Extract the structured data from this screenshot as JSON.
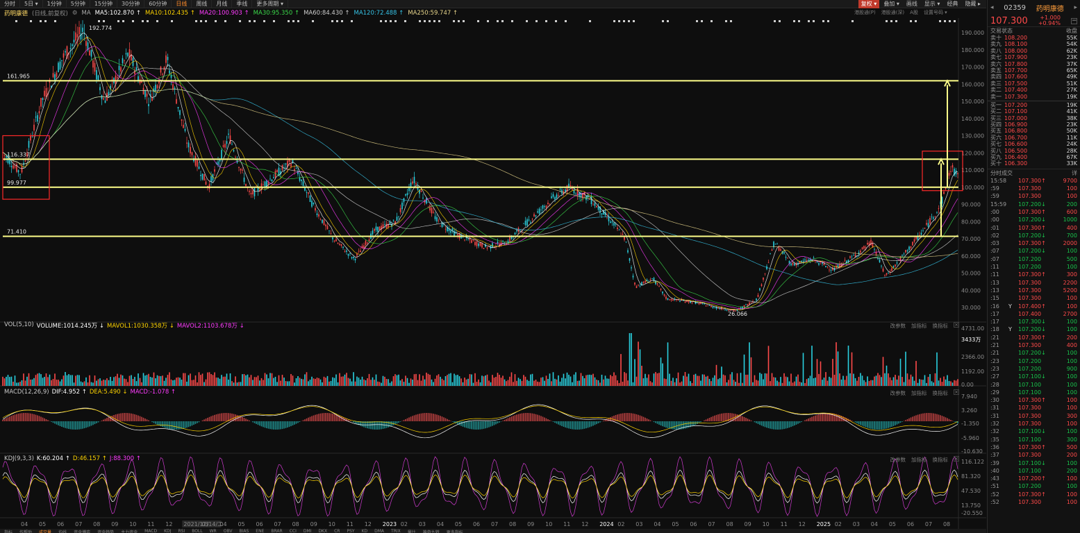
{
  "toolbar": {
    "periods": [
      "分时",
      "5日 ▾",
      "1分钟",
      "5分钟",
      "15分钟",
      "30分钟",
      "60分钟",
      "日线",
      "周线",
      "月线",
      "季线",
      "更多周期 ▾"
    ],
    "active_period": "日线",
    "right": [
      "复权 ▾",
      "叠加 ▾",
      "画线",
      "显示 ▾",
      "经典",
      "隐藏 ▸"
    ]
  },
  "subbar": [
    "港股通(P)",
    "港股通(深)",
    "A股",
    "设置号码 ▾"
  ],
  "ma_legend": {
    "name": "药明康德",
    "sub": "(日线,前复权)",
    "items": [
      {
        "text": "MA5:102.870 ↑",
        "color": "#ffffff"
      },
      {
        "text": "MA10:102.435 ↑",
        "color": "#ffd400"
      },
      {
        "text": "MA20:100.903 ↑",
        "color": "#ff3bff"
      },
      {
        "text": "MA30:95.350 ↑",
        "color": "#3bd94a"
      },
      {
        "text": "MA60:84.430 ↑",
        "color": "#d0d0d0"
      },
      {
        "text": "MA120:72.488 ↑",
        "color": "#36c3e6"
      },
      {
        "text": "MA250:59.747 ↑",
        "color": "#e6d48a"
      }
    ]
  },
  "price_pane": {
    "y_ticks": [
      "190.000",
      "180.000",
      "170.000",
      "160.000",
      "150.000",
      "140.000",
      "130.000",
      "120.000",
      "110.000",
      "100.000",
      "90.000",
      "80.000",
      "70.000",
      "60.000",
      "50.000",
      "40.000",
      "30.000"
    ],
    "levels": [
      {
        "label": "161.965",
        "value": 161.965
      },
      {
        "label": "116.337",
        "value": 116.337
      },
      {
        "label": "99.977",
        "value": 99.977
      },
      {
        "label": "71.410",
        "value": 71.41
      }
    ],
    "high_label": "192.774",
    "low_label": "26.066"
  },
  "vol_pane": {
    "legend": [
      {
        "text": "VOL(5,10)",
        "color": "#c8c8c8"
      },
      {
        "text": "VOLUME:1014.245万 ↓",
        "color": "#ffffff"
      },
      {
        "text": "MAVOL1:1030.358万 ↓",
        "color": "#ffd400"
      },
      {
        "text": "MAVOL2:1103.678万 ↓",
        "color": "#ff3bff"
      }
    ],
    "y_ticks": [
      "4731.00",
      "3433万",
      "2366.00",
      "1192.00",
      "0.00"
    ]
  },
  "macd_pane": {
    "legend": [
      {
        "text": "MACD(12,26,9)",
        "color": "#c8c8c8"
      },
      {
        "text": "DIF:4.952 ↑",
        "color": "#ffffff"
      },
      {
        "text": "DEA:5.490 ↓",
        "color": "#ffd400"
      },
      {
        "text": "MACD:-1.078 ↑",
        "color": "#ff3bff"
      }
    ],
    "y_ticks": [
      "7.940",
      "3.260",
      "-1.350",
      "-5.960",
      "-10.630"
    ]
  },
  "kdj_pane": {
    "legend": [
      {
        "text": "KDJ(9,3,3)",
        "color": "#c8c8c8"
      },
      {
        "text": "K:60.204 ↑",
        "color": "#ffffff"
      },
      {
        "text": "D:46.157 ↑",
        "color": "#ffd400"
      },
      {
        "text": "J:88.300 ↑",
        "color": "#ff3bff"
      }
    ],
    "y_ticks": [
      "116.122",
      "81.320",
      "47.530",
      "13.750",
      "-20.550"
    ]
  },
  "pane_ops": [
    "改参数",
    "加指标",
    "换指标",
    "×"
  ],
  "x_axis": [
    "04",
    "05",
    "06",
    "07",
    "08",
    "09",
    "10",
    "11",
    "12",
    "2021/12/14/二",
    "03",
    "04",
    "05",
    "06",
    "07",
    "08",
    "09",
    "10",
    "11",
    "12",
    "2023",
    "02",
    "03",
    "04",
    "05",
    "06",
    "07",
    "08",
    "09",
    "10",
    "11",
    "12",
    "2024",
    "02",
    "03",
    "04",
    "05",
    "06",
    "07",
    "08",
    "09",
    "10",
    "11",
    "12",
    "2025",
    "02",
    "03",
    "04",
    "05",
    "06",
    "07",
    "08"
  ],
  "bottom_tabs": [
    "指标",
    "作帮助",
    "成交量",
    "均线",
    "资金博弈",
    "资金趋势",
    "主力资金",
    "MACD",
    "KDJ",
    "RSI",
    "BOLL",
    "WR",
    "OBV",
    "BIAS",
    "ENE",
    "BRAR",
    "CCI",
    "DMI",
    "DKX",
    "CR",
    "PSY",
    "KD",
    "DMA",
    "TRIX",
    "量比",
    "神奇九转",
    "更多指标"
  ],
  "panel": {
    "code": "02359",
    "name": "药明康德",
    "price": "107.300",
    "change": "+1.000",
    "change_pct": "+0.94%",
    "orderbook_title": "交易状态",
    "orderbook_right": "收盘",
    "asks": [
      {
        "label": "卖十",
        "price": "108.200",
        "vol": "55K"
      },
      {
        "label": "卖九",
        "price": "108.100",
        "vol": "54K"
      },
      {
        "label": "卖八",
        "price": "108.000",
        "vol": "62K"
      },
      {
        "label": "卖七",
        "price": "107.900",
        "vol": "23K"
      },
      {
        "label": "卖六",
        "price": "107.800",
        "vol": "37K"
      },
      {
        "label": "卖五",
        "price": "107.700",
        "vol": "65K"
      },
      {
        "label": "卖四",
        "price": "107.600",
        "vol": "49K"
      },
      {
        "label": "卖三",
        "price": "107.500",
        "vol": "51K"
      },
      {
        "label": "卖二",
        "price": "107.400",
        "vol": "27K"
      },
      {
        "label": "卖一",
        "price": "107.300",
        "vol": "19K"
      }
    ],
    "bids": [
      {
        "label": "买一",
        "price": "107.200",
        "vol": "19K"
      },
      {
        "label": "买二",
        "price": "107.100",
        "vol": "41K"
      },
      {
        "label": "买三",
        "price": "107.000",
        "vol": "38K"
      },
      {
        "label": "买四",
        "price": "106.900",
        "vol": "23K"
      },
      {
        "label": "买五",
        "price": "106.800",
        "vol": "50K"
      },
      {
        "label": "买六",
        "price": "106.700",
        "vol": "11K"
      },
      {
        "label": "买七",
        "price": "106.600",
        "vol": "24K"
      },
      {
        "label": "买八",
        "price": "106.500",
        "vol": "28K"
      },
      {
        "label": "买九",
        "price": "106.400",
        "vol": "67K"
      },
      {
        "label": "买十",
        "price": "106.300",
        "vol": "33K"
      }
    ],
    "ticks_title": "分时成交",
    "ticks_right": "详",
    "ticks": [
      {
        "t": "15:58",
        "f": "",
        "p": "107.300↑",
        "v": "9700",
        "d": "up"
      },
      {
        "t": ":59",
        "f": "",
        "p": "107.300",
        "v": "100",
        "d": "up"
      },
      {
        "t": ":59",
        "f": "",
        "p": "107.300",
        "v": "100",
        "d": "up"
      },
      {
        "t": "15:59",
        "f": "",
        "p": "107.200↓",
        "v": "200",
        "d": "dn"
      },
      {
        "t": ":00",
        "f": "",
        "p": "107.300↑",
        "v": "600",
        "d": "up"
      },
      {
        "t": ":00",
        "f": "",
        "p": "107.200↓",
        "v": "1000",
        "d": "dn"
      },
      {
        "t": ":01",
        "f": "",
        "p": "107.300↑",
        "v": "400",
        "d": "up"
      },
      {
        "t": ":02",
        "f": "",
        "p": "107.200↓",
        "v": "700",
        "d": "dn"
      },
      {
        "t": ":03",
        "f": "",
        "p": "107.300↑",
        "v": "2000",
        "d": "up"
      },
      {
        "t": ":07",
        "f": "",
        "p": "107.200↓",
        "v": "100",
        "d": "dn"
      },
      {
        "t": ":07",
        "f": "",
        "p": "107.200",
        "v": "500",
        "d": "dn"
      },
      {
        "t": ":11",
        "f": "",
        "p": "107.200",
        "v": "100",
        "d": "dn"
      },
      {
        "t": ":11",
        "f": "",
        "p": "107.300↑",
        "v": "300",
        "d": "up"
      },
      {
        "t": ":13",
        "f": "",
        "p": "107.300",
        "v": "2200",
        "d": "up"
      },
      {
        "t": ":13",
        "f": "",
        "p": "107.300",
        "v": "5200",
        "d": "up"
      },
      {
        "t": ":15",
        "f": "",
        "p": "107.300",
        "v": "100",
        "d": "up"
      },
      {
        "t": ":16",
        "f": "Y",
        "p": "107.400↑",
        "v": "100",
        "d": "up"
      },
      {
        "t": ":17",
        "f": "",
        "p": "107.400",
        "v": "2700",
        "d": "up"
      },
      {
        "t": ":17",
        "f": "",
        "p": "107.300↓",
        "v": "100",
        "d": "dn"
      },
      {
        "t": ":18",
        "f": "Y",
        "p": "107.200↓",
        "v": "100",
        "d": "dn"
      },
      {
        "t": ":21",
        "f": "",
        "p": "107.300↑",
        "v": "200",
        "d": "up"
      },
      {
        "t": ":21",
        "f": "",
        "p": "107.300",
        "v": "400",
        "d": "up"
      },
      {
        "t": ":21",
        "f": "",
        "p": "107.200↓",
        "v": "100",
        "d": "dn"
      },
      {
        "t": ":23",
        "f": "",
        "p": "107.200",
        "v": "100",
        "d": "dn"
      },
      {
        "t": ":23",
        "f": "",
        "p": "107.200",
        "v": "900",
        "d": "dn"
      },
      {
        "t": ":27",
        "f": "",
        "p": "107.100↓",
        "v": "100",
        "d": "dn"
      },
      {
        "t": ":28",
        "f": "",
        "p": "107.100",
        "v": "100",
        "d": "dn"
      },
      {
        "t": ":29",
        "f": "",
        "p": "107.100",
        "v": "100",
        "d": "dn"
      },
      {
        "t": ":30",
        "f": "",
        "p": "107.300↑",
        "v": "100",
        "d": "up"
      },
      {
        "t": ":31",
        "f": "",
        "p": "107.300",
        "v": "100",
        "d": "up"
      },
      {
        "t": ":31",
        "f": "",
        "p": "107.300",
        "v": "300",
        "d": "up"
      },
      {
        "t": ":32",
        "f": "",
        "p": "107.300",
        "v": "100",
        "d": "up"
      },
      {
        "t": ":32",
        "f": "",
        "p": "107.100↓",
        "v": "100",
        "d": "dn"
      },
      {
        "t": ":35",
        "f": "",
        "p": "107.100",
        "v": "300",
        "d": "dn"
      },
      {
        "t": ":36",
        "f": "",
        "p": "107.300↑",
        "v": "500",
        "d": "up"
      },
      {
        "t": ":37",
        "f": "",
        "p": "107.300",
        "v": "200",
        "d": "up"
      },
      {
        "t": ":39",
        "f": "",
        "p": "107.100↓",
        "v": "100",
        "d": "dn"
      },
      {
        "t": ":40",
        "f": "",
        "p": "107.100",
        "v": "200",
        "d": "dn"
      },
      {
        "t": ":43",
        "f": "",
        "p": "107.200↑",
        "v": "100",
        "d": "up"
      },
      {
        "t": ":51",
        "f": "",
        "p": "107.200",
        "v": "100",
        "d": "dn"
      },
      {
        "t": ":52",
        "f": "",
        "p": "107.300↑",
        "v": "100",
        "d": "up"
      },
      {
        "t": ":52",
        "f": "",
        "p": "107.300",
        "v": "100",
        "d": "up"
      }
    ]
  }
}
